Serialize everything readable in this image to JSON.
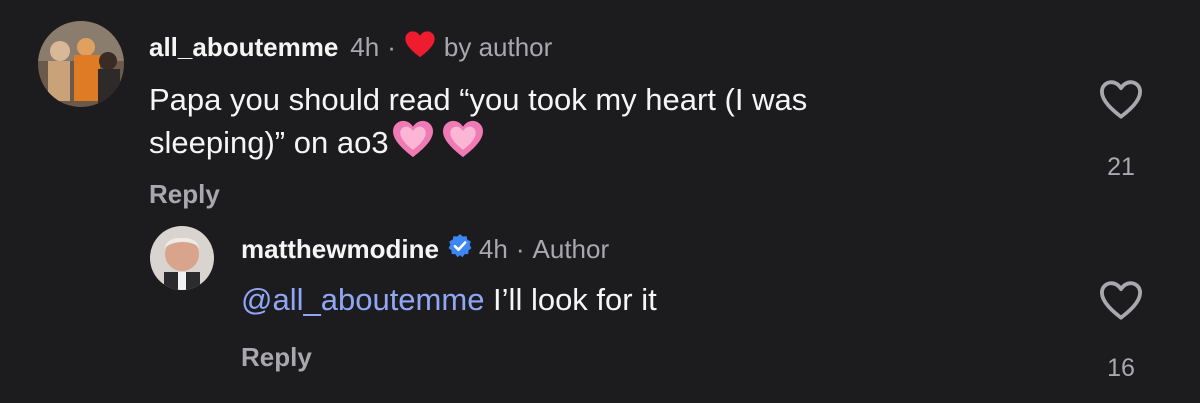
{
  "comments": [
    {
      "username": "all_aboutemme",
      "time": "4h",
      "separator": "·",
      "liked_by": "by author",
      "text": "Papa you should read “you took my heart (I was sleeping)” on ao3",
      "emoji": [
        "pink-heart",
        "pink-heart"
      ],
      "reply_label": "Reply",
      "like_count": "21"
    },
    {
      "username": "matthewmodine",
      "verified": true,
      "time": "4h",
      "separator": "·",
      "role": "Author",
      "mention": "@all_aboutemme",
      "text": " I’ll look for it",
      "reply_label": "Reply",
      "like_count": "16"
    }
  ],
  "colors": {
    "background": "#1c1c1f",
    "mention": "#8fa7f5",
    "secondary_text": "#a8a8ad",
    "liked_heart": "#ed1c2e",
    "verified_badge": "#3d87f5",
    "emoji_heart": "#f78fbf"
  },
  "icons": [
    "heart-outline-icon",
    "heart-filled-icon",
    "verified-badge-icon",
    "pink-heart-emoji"
  ]
}
